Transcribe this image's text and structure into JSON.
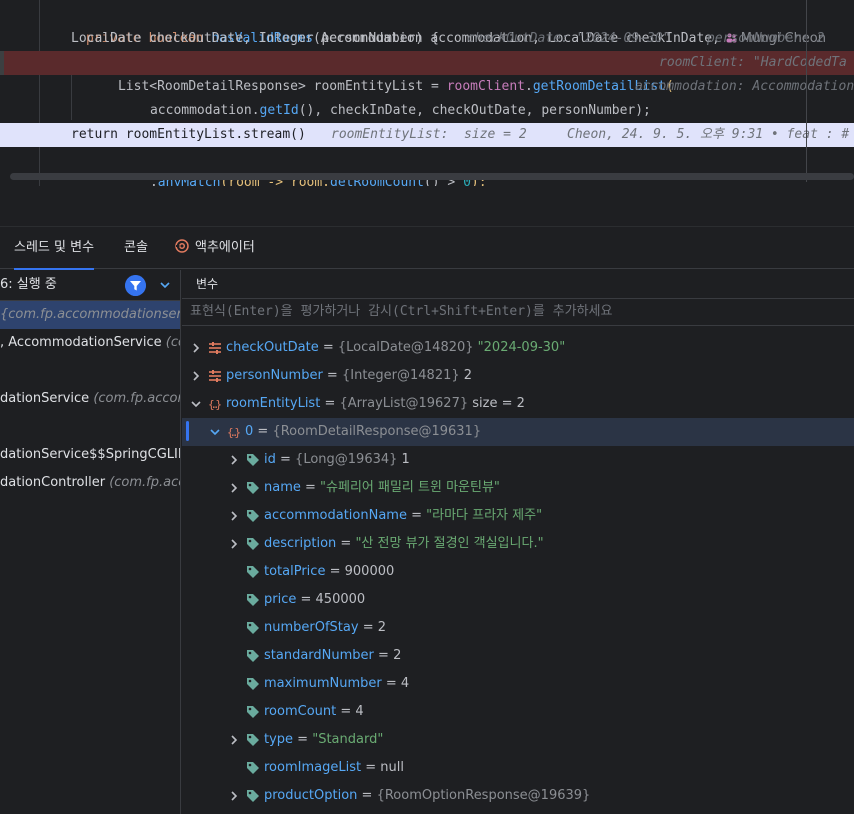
{
  "editor": {
    "lines": [
      {
        "parts": [
          "private boolean ",
          "hasValidRooms",
          "(Accommodation accommodation, LocalDate checkInDate,"
        ],
        "author": "Mungi Cheon"
      },
      {
        "parts": [
          "LocalDate checkOutDate, Integer personNumber) {"
        ],
        "hints": [
          "checkOutDate: \"2024-09-30\"",
          "personNumber: 2"
        ]
      },
      {
        "parts": [
          "List<RoomDetailResponse> roomEntityList = ",
          "roomClient",
          ".",
          "getRoomDetailList",
          "("
        ],
        "hint": "roomClient: \"HardCodedTa"
      },
      {
        "parts": [
          "accommodation.",
          "getId",
          "(), checkInDate, checkOutDate, personNumber);"
        ],
        "hint": "accommodation: Accommodation"
      },
      {
        "parts": [
          ""
        ]
      },
      {
        "parts": [
          "return roomEntityList.stream()"
        ],
        "hints": [
          "roomEntityList:  size = 2",
          "Cheon, 24. 9. 5. 오후 9:31 • feat : #"
        ]
      },
      {
        "parts": [
          ".",
          "anyMatch",
          "(room -> room.",
          "getRoomCount",
          "() > ",
          "0",
          ");"
        ]
      }
    ]
  },
  "debug": {
    "tabs": [
      {
        "label": "스레드 및 변수"
      },
      {
        "label": "콘솔"
      },
      {
        "label": "액추에이터"
      }
    ],
    "frames_header": "6: 실행 중",
    "frames": [
      {
        "name": "",
        "pkg": "{com.fp.accommodationservi"
      },
      {
        "name": ", AccommodationService ",
        "pkg": "(co"
      },
      {
        "name": "",
        "pkg": ""
      },
      {
        "name": "dationService ",
        "pkg": "(com.fp.accon"
      },
      {
        "name": "",
        "pkg": ""
      },
      {
        "name": "dationService$$SpringCGLIBS",
        "pkg": ""
      },
      {
        "name": "dationController ",
        "pkg": "(com.fp.acc"
      }
    ],
    "vars_header": "변수",
    "eval_placeholder": "표현식(Enter)을 평가하거나 감시(Ctrl+Shift+Enter)를 추가하세요",
    "variables": [
      {
        "name": "checkOutDate",
        "type": "{LocalDate@14820}",
        "value": "\"2024-09-30\"",
        "value_kind": "string"
      },
      {
        "name": "personNumber",
        "type": "{Integer@14821}",
        "value": "2",
        "value_kind": "plain"
      },
      {
        "name": "roomEntityList",
        "type": "{ArrayList@19627}",
        "value": "size = 2",
        "value_kind": "plain"
      },
      {
        "name": "0",
        "type": "{RoomDetailResponse@19631}",
        "value": "",
        "value_kind": "plain"
      },
      {
        "name": "id",
        "type": "{Long@19634}",
        "value": "1",
        "value_kind": "plain"
      },
      {
        "name": "name",
        "type": "",
        "value": "\"슈페리어 패밀리 트윈 마운틴뷰\"",
        "value_kind": "string"
      },
      {
        "name": "accommodationName",
        "type": "",
        "value": "\"라마다 프라자 제주\"",
        "value_kind": "string"
      },
      {
        "name": "description",
        "type": "",
        "value": "\"산 전망 뷰가 절경인 객실입니다.\"",
        "value_kind": "string"
      },
      {
        "name": "totalPrice",
        "type": "",
        "value": "900000",
        "value_kind": "plain"
      },
      {
        "name": "price",
        "type": "",
        "value": "450000",
        "value_kind": "plain"
      },
      {
        "name": "numberOfStay",
        "type": "",
        "value": "2",
        "value_kind": "plain"
      },
      {
        "name": "standardNumber",
        "type": "",
        "value": "2",
        "value_kind": "plain"
      },
      {
        "name": "maximumNumber",
        "type": "",
        "value": "4",
        "value_kind": "plain"
      },
      {
        "name": "roomCount",
        "type": "",
        "value": "4",
        "value_kind": "plain"
      },
      {
        "name": "type",
        "type": "",
        "value": "\"Standard\"",
        "value_kind": "string"
      },
      {
        "name": "roomImageList",
        "type": "",
        "value": "null",
        "value_kind": "plain"
      },
      {
        "name": "productOption",
        "type": "{RoomOptionResponse@19639}",
        "value": "",
        "value_kind": "plain"
      }
    ]
  },
  "colors": {
    "accent": "#3574f0",
    "breakpoint_line": "#5a2a2c",
    "string": "#6aab73",
    "field_name": "#56a8f5"
  }
}
